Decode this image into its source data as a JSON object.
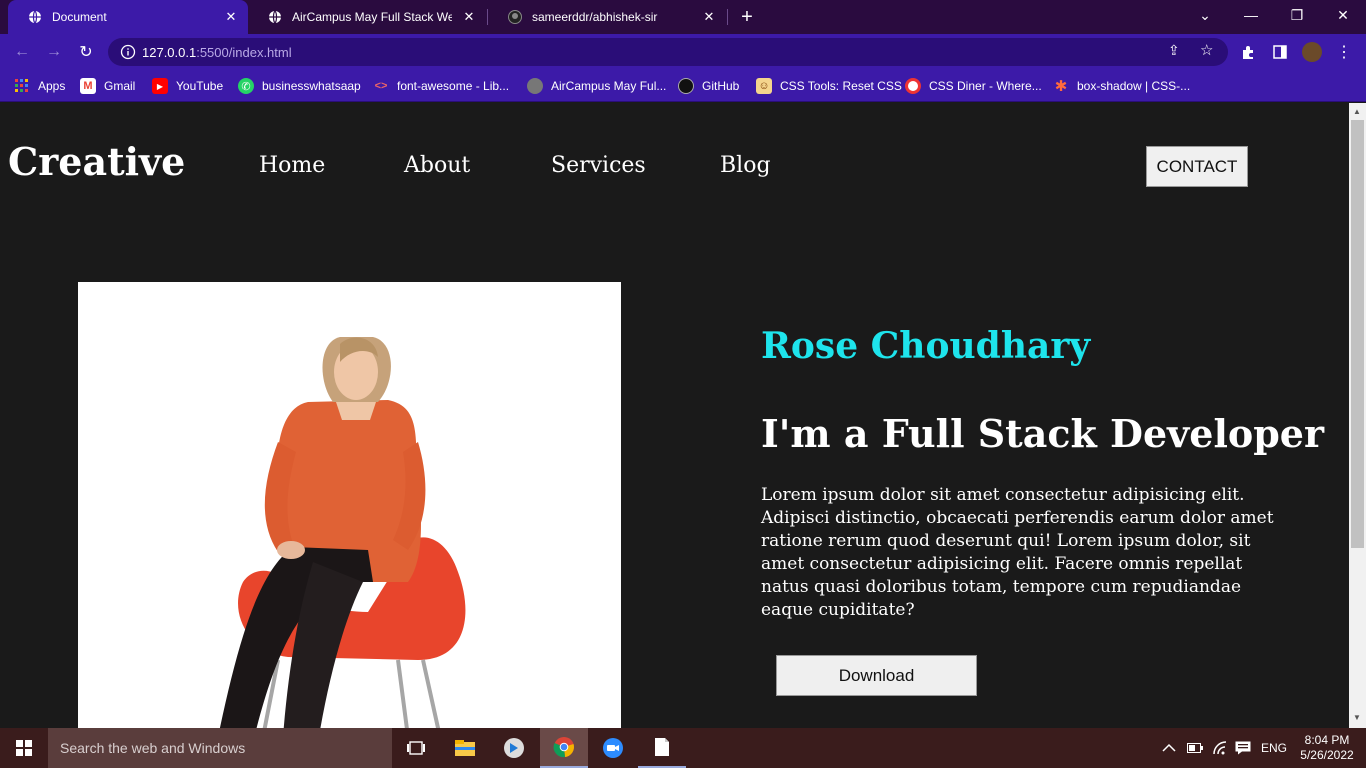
{
  "browser": {
    "tabs": [
      {
        "title": "Document",
        "icon": "globe-icon",
        "active": true
      },
      {
        "title": "AirCampus May Full Stack Web D",
        "icon": "globe-icon",
        "active": false
      },
      {
        "title": "sameerddr/abhishek-sir",
        "icon": "github-icon",
        "active": false
      }
    ],
    "url_host": "127.0.0.1",
    "url_path": ":5500/index.html",
    "bookmarks": [
      {
        "label": "Apps",
        "icon": "apps-grid-icon"
      },
      {
        "label": "Gmail",
        "icon": "gmail-icon"
      },
      {
        "label": "YouTube",
        "icon": "youtube-icon"
      },
      {
        "label": "businesswhatsaap",
        "icon": "whatsapp-icon"
      },
      {
        "label": "font-awesome - Lib...",
        "icon": "code-icon"
      },
      {
        "label": "AirCampus May Ful...",
        "icon": "globe-icon"
      },
      {
        "label": "GitHub",
        "icon": "github-icon"
      },
      {
        "label": "CSS Tools: Reset CSS",
        "icon": "css-tools-icon"
      },
      {
        "label": "CSS Diner - Where...",
        "icon": "css-diner-icon"
      },
      {
        "label": "box-shadow | CSS-...",
        "icon": "star-burst-icon"
      }
    ]
  },
  "site": {
    "logo": "Creative",
    "nav": [
      "Home",
      "About",
      "Services",
      "Blog"
    ],
    "contact_label": "CONTACT",
    "name": "Rose Choudhary",
    "role": "I'm a Full Stack Developer",
    "bio": "Lorem ipsum dolor sit amet consectetur adipisicing elit. Adipisci distinctio, obcaecati perferendis earum dolor amet ratione rerum quod deserunt qui! Lorem ipsum dolor, sit amet consectetur adipisicing elit. Facere omnis repellat natus quasi doloribus totam, tempore cum repudiandae eaque cupiditate?",
    "download_label": "Download"
  },
  "taskbar": {
    "search_placeholder": "Search the web and Windows",
    "language": "ENG",
    "time": "8:04 PM",
    "date": "5/26/2022"
  },
  "colors": {
    "accent": "#1ee4ec",
    "tab_bar": "#2a0b3f",
    "toolbar": "#3c1aa8",
    "page_bg": "#1a1a1a"
  }
}
